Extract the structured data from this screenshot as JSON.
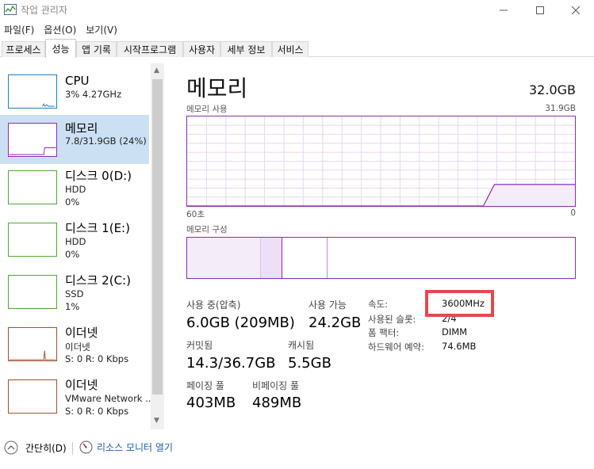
{
  "window": {
    "title": "작업 관리자"
  },
  "menu": [
    "파일(F)",
    "옵션(O)",
    "보기(V)"
  ],
  "tabs": [
    "프로세스",
    "성능",
    "앱 기록",
    "시작프로그램",
    "사용자",
    "세부 정보",
    "서비스"
  ],
  "sidebar": {
    "items": [
      {
        "name": "CPU",
        "sub1": "3%  4.27GHz",
        "sub2": ""
      },
      {
        "name": "메모리",
        "sub1": "7.8/31.9GB (24%)",
        "sub2": ""
      },
      {
        "name": "디스크 0(D:)",
        "sub1": "HDD",
        "sub2": "0%"
      },
      {
        "name": "디스크 1(E:)",
        "sub1": "HDD",
        "sub2": "0%"
      },
      {
        "name": "디스크 2(C:)",
        "sub1": "SSD",
        "sub2": "1%"
      },
      {
        "name": "이더넷",
        "sub1": "이더넷",
        "sub2": "S: 0  R: 0 Kbps"
      },
      {
        "name": "이더넷",
        "sub1": "VMware Network ...",
        "sub2": "S: 0  R: 0 Kbps"
      }
    ]
  },
  "main": {
    "title": "메모리",
    "total": "32.0GB",
    "graph": {
      "label": "메모리 사용",
      "max_label": "31.9GB",
      "time_label": "60초",
      "zero_label": "0",
      "usage_fraction": 0.24
    },
    "composition_label": "메모리 구성",
    "stats": {
      "in_use_label": "사용 중(압축)",
      "in_use_value": "6.0GB (209MB)",
      "available_label": "사용 가능",
      "available_value": "24.2GB",
      "committed_label": "커밋됨",
      "committed_value": "14.3/36.7GB",
      "cached_label": "캐시됨",
      "cached_value": "5.5GB",
      "paged_label": "페이징 풀",
      "paged_value": "403MB",
      "nonpaged_label": "비페이징 풀",
      "nonpaged_value": "489MB"
    },
    "details": [
      {
        "label": "속도:",
        "value": "3600MHz"
      },
      {
        "label": "사용된 슬롯:",
        "value": "2/4"
      },
      {
        "label": "폼 팩터:",
        "value": "DIMM"
      },
      {
        "label": "하드웨어 예약:",
        "value": "74.6MB"
      }
    ]
  },
  "footer": {
    "collapse_label": "간단히(D)",
    "resmon_label": "리소스 모니터 열기"
  },
  "colors": {
    "memory_accent": "#8b2bb5",
    "cpu_accent": "#1a7fc1",
    "disk_accent": "#4fa832",
    "net_accent": "#a0522d",
    "highlight": "#e5484f",
    "selected_bg": "#cce0f4"
  }
}
